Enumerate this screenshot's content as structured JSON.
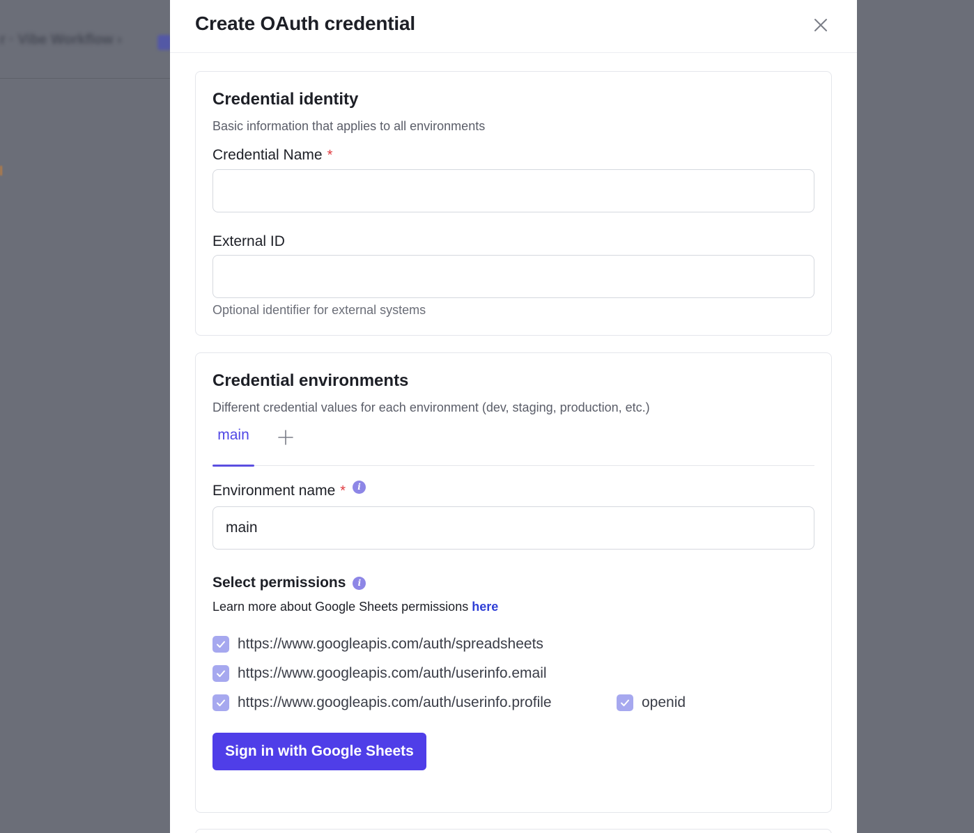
{
  "background": {
    "breadcrumb": "r  ·  Vibe Workflow  ›"
  },
  "modal": {
    "title": "Create OAuth credential",
    "close_icon": "close-icon"
  },
  "identity": {
    "title": "Credential identity",
    "subtitle": "Basic information that applies to all environments",
    "name_label": "Credential Name",
    "required_mark": "*",
    "name_value": "",
    "external_id_label": "External ID",
    "external_id_value": "",
    "external_id_hint": "Optional identifier for external systems"
  },
  "environments": {
    "title": "Credential environments",
    "subtitle": "Different credential values for each environment (dev, staging, production, etc.)",
    "tabs": [
      {
        "label": "main",
        "active": true
      }
    ],
    "add_tab_icon": "plus-icon",
    "env_name_label": "Environment name",
    "required_mark": "*",
    "info_icon": "info-icon",
    "info_glyph": "i",
    "env_name_value": "main"
  },
  "permissions": {
    "title": "Select permissions",
    "learn_text": "Learn more about Google Sheets permissions ",
    "learn_link": "here",
    "scopes": [
      {
        "label": "https://www.googleapis.com/auth/spreadsheets",
        "checked": true
      },
      {
        "label": "https://www.googleapis.com/auth/userinfo.email",
        "checked": true
      },
      {
        "label": "https://www.googleapis.com/auth/userinfo.profile",
        "checked": true
      },
      {
        "label": "openid",
        "checked": true
      }
    ],
    "signin_label": "Sign in with Google Sheets"
  },
  "colors": {
    "accent": "#4f3ee8",
    "tab_active": "#4f46e5",
    "checkbox": "#a6a8ef",
    "required": "#e0393e",
    "link": "#2f3fd6",
    "overlay": "#6b6e78"
  }
}
